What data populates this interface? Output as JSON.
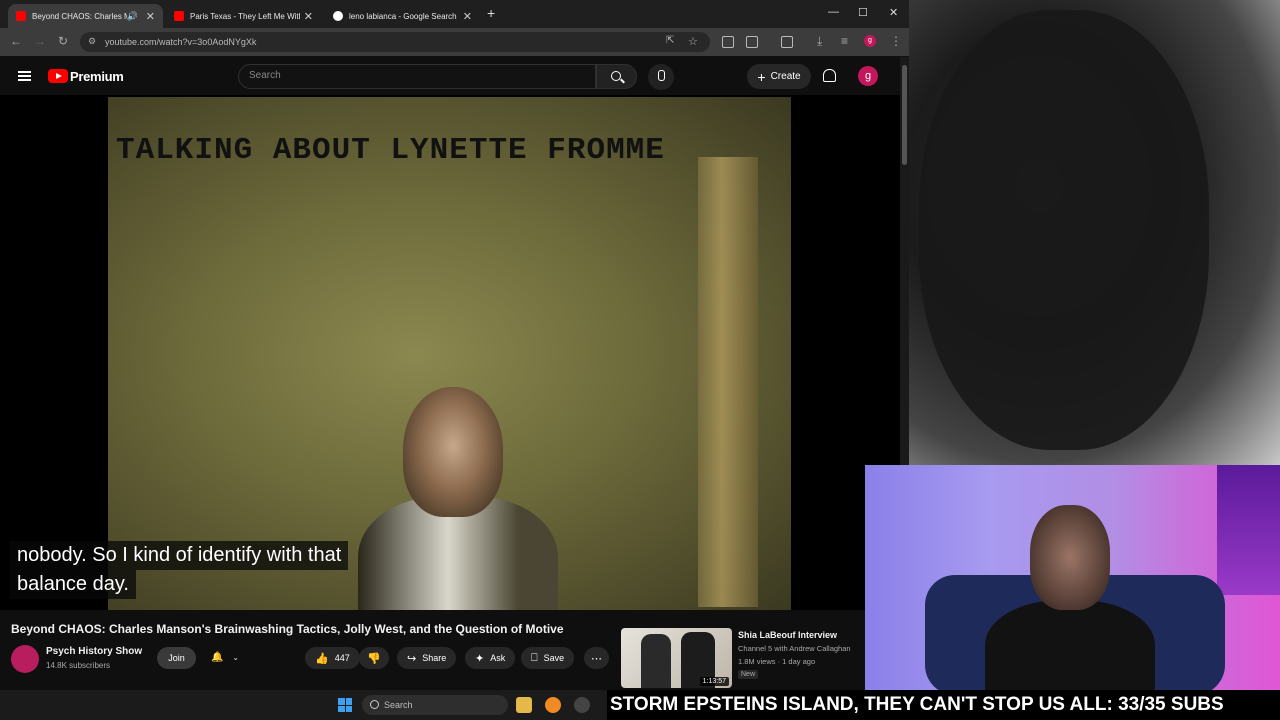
{
  "browser": {
    "tabs": [
      {
        "title": "Beyond CHAOS: Charles Ma",
        "favicon": "youtube-icon",
        "active": true
      },
      {
        "title": "Paris Texas - They Left Me With",
        "favicon": "youtube-icon",
        "active": false
      },
      {
        "title": "leno labianca - Google Search",
        "favicon": "google-icon",
        "active": false
      }
    ],
    "url": "youtube.com/watch?v=3o0AodNYgXk"
  },
  "youtube": {
    "brand": "Premium",
    "search_placeholder": "Search",
    "create_label": "Create",
    "avatar_letter": "g"
  },
  "video": {
    "overlay_title": "TALKING ABOUT LYNETTE FROMME",
    "captions": [
      "nobody. So I kind of identify with that",
      "balance day."
    ],
    "title": "Beyond CHAOS: Charles Manson's Brainwashing Tactics, Jolly West, and the Question of Motive",
    "channel_name": "Psych History Show",
    "channel_subs": "14.8K subscribers",
    "join_label": "Join",
    "likes": "447",
    "share_label": "Share",
    "ask_label": "Ask",
    "save_label": "Save"
  },
  "recommendation": {
    "title": "Shia LaBeouf Interview",
    "channel": "Channel 5 with Andrew Callaghan",
    "meta": "1.8M views · 1 day ago",
    "badge": "New",
    "duration": "1:13:57"
  },
  "taskbar": {
    "search_label": "Search"
  },
  "ticker": {
    "text": "STORM EPSTEINS ISLAND, THEY CAN'T STOP US ALL: 33/35 SUBS"
  },
  "colors": {
    "youtube_red": "#ff0000",
    "avatar_pink": "#c2185b",
    "background": "#0f0f0f"
  }
}
